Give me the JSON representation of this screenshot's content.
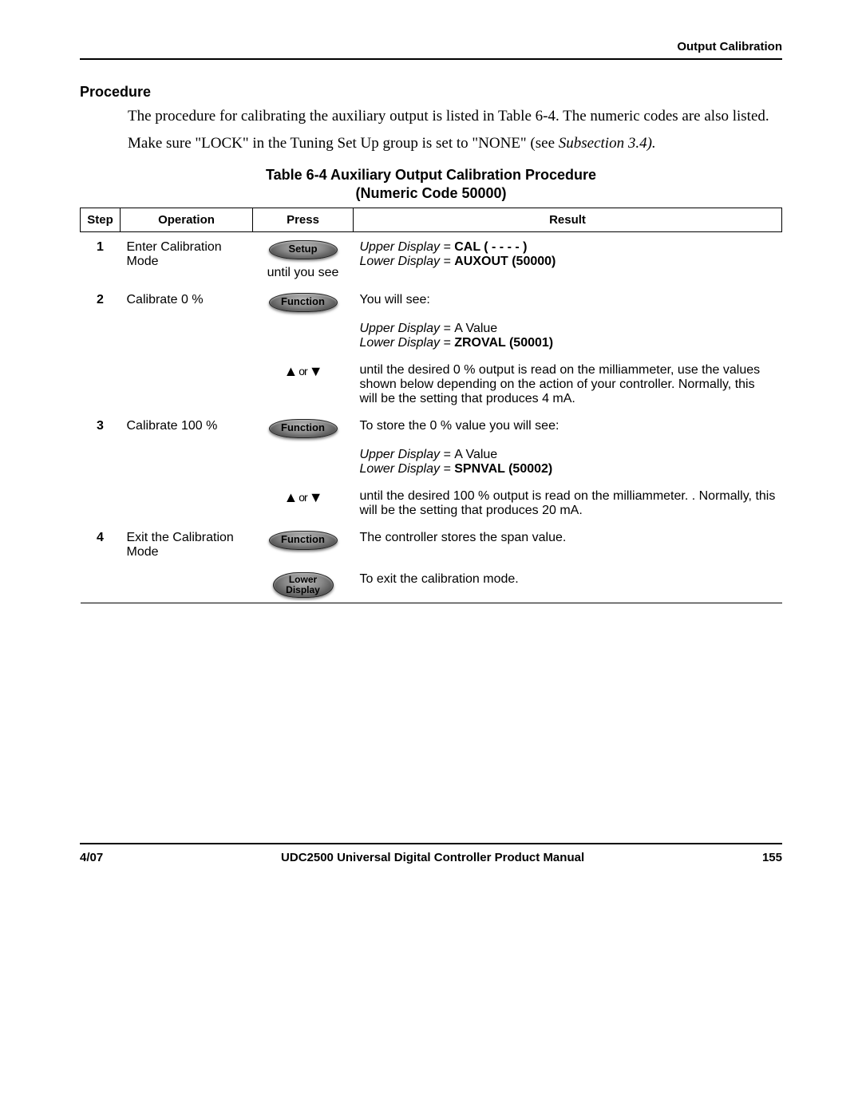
{
  "header": {
    "section": "Output Calibration"
  },
  "section_heading": "Procedure",
  "para1": "The procedure for calibrating the auxiliary output is listed in Table 6-4. The numeric codes are also listed.",
  "para2_a": "Make sure \"LOCK\" in the Tuning Set Up group is set to \"NONE\" (see ",
  "para2_b": "Subsection 3.4).",
  "table_title_line1": "Table 6-4  Auxiliary Output Calibration Procedure",
  "table_title_line2": "(Numeric Code 50000)",
  "columns": {
    "step": "Step",
    "operation": "Operation",
    "press": "Press",
    "result": "Result"
  },
  "keys": {
    "setup": "Setup",
    "function": "Function",
    "lower_display_l1": "Lower",
    "lower_display_l2": "Display"
  },
  "arrows": {
    "up": "▲",
    "or": "or",
    "down": "▼"
  },
  "steps": {
    "s1": {
      "num": "1",
      "op": "Enter Calibration Mode",
      "note_below": "until you see",
      "r_up_label": "Upper Display = ",
      "r_up_val": "CAL ( - - - - )",
      "r_lo_label": "Lower Display = ",
      "r_lo_val": "AUXOUT (50000)"
    },
    "s2a": {
      "num": "2",
      "op": "Calibrate 0 %",
      "r_intro": "You will see:",
      "r_up_label": "Upper Display = ",
      "r_up_val": "A Value",
      "r_lo_label": "Lower Display = ",
      "r_lo_val": "ZROVAL (50001)"
    },
    "s2b": {
      "text": "until the desired 0 % output is read on the milliammeter, use the values shown below depending on the action of your controller.  Normally, this will be the setting that produces 4 mA."
    },
    "s3a": {
      "num": "3",
      "op": "Calibrate 100 %",
      "r_intro": "To store the 0 % value you will see:",
      "r_up_label": "Upper Display = ",
      "r_up_val": "A Value",
      "r_lo_label": "Lower Display = ",
      "r_lo_val": "SPNVAL (50002)"
    },
    "s3b": {
      "text": "until the desired 100 % output is read on the milliammeter. . Normally, this will be the setting that produces 20 mA."
    },
    "s4a": {
      "num": "4",
      "op": "Exit the Calibration Mode",
      "text": "The controller stores the span value."
    },
    "s4b": {
      "text": "To exit the calibration mode."
    }
  },
  "footer": {
    "left": "4/07",
    "center": "UDC2500 Universal Digital Controller Product Manual",
    "right": "155"
  }
}
